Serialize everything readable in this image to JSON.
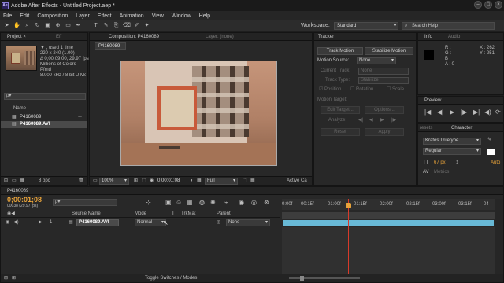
{
  "window": {
    "title": "Adobe After Effects - Untitled Project.aep *",
    "app_icon": "Ae"
  },
  "menu": [
    "File",
    "Edit",
    "Composition",
    "Layer",
    "Effect",
    "Animation",
    "View",
    "Window",
    "Help"
  ],
  "toolbar": {
    "workspace_label": "Workspace:",
    "workspace_value": "Standard",
    "search_placeholder": "Search Help"
  },
  "project": {
    "tab_label": "Project ×",
    "tab2_label": "Eff",
    "footage_name": "▼ , used 1 time",
    "footage_info": [
      "220 x 240 (1.00)",
      "Δ 0;00:09;00, 29.97 fps",
      "Millions of Colors",
      "Pfmd",
      "8.000 kHz / 8 bit U Mono"
    ],
    "search_placeholder": "ρ▾",
    "column_name": "Name",
    "items": [
      {
        "name": "P4160089",
        "type": "comp"
      },
      {
        "name": "P4160089.AVI",
        "type": "footage"
      }
    ],
    "bpc": "8 bpc"
  },
  "composition": {
    "tab_label": "Composition: P4160089",
    "layer_tab": "Layer: (none)",
    "comp_name": "P4160089",
    "zoom": "100%",
    "timecode": "0;00:01:08",
    "resolution": "Full",
    "camera": "Active Ca"
  },
  "tracker": {
    "tab_label": "Tracker",
    "track_motion": "Track Motion",
    "stabilize_motion": "Stabilize Motion",
    "motion_source_label": "Motion Source:",
    "motion_source_value": "None",
    "current_track_label": "Current Track:",
    "current_track_value": "None",
    "track_type_label": "Track Type:",
    "track_type_value": "Stabilize",
    "position": "Position",
    "rotation": "Rotation",
    "scale": "Scale",
    "motion_target": "Motion Target:",
    "edit_target": "Edit Target...",
    "options": "Options...",
    "analyze": "Analyze:",
    "reset": "Reset",
    "apply": "Apply"
  },
  "info": {
    "tab_label": "Info",
    "tab2_label": "Audio",
    "r": "R :",
    "g": "G :",
    "b": "B :",
    "a": "A : 0",
    "x": "X : 262",
    "y": "Y : 251"
  },
  "preview": {
    "tab_label": "Preview"
  },
  "character": {
    "tab1_label": "resets",
    "tab2_label": "Character",
    "font": "Kratos Truetype",
    "style": "Regular",
    "size": "67 px",
    "auto": "Auto",
    "metrics": "Metrics"
  },
  "timeline": {
    "tab_label": "P4160089",
    "timecode": "0;00:01;08",
    "fps": "00038 (29.97 fps)",
    "search_placeholder": "ρ▾",
    "col_source": "Source Name",
    "col_mode": "Mode",
    "col_t": "T",
    "col_trkmat": "TrkMat",
    "col_parent": "Parent",
    "layer_num": "1",
    "layer_name": "P4160089.AVI",
    "layer_mode": "Normal",
    "layer_parent": "None",
    "ruler": [
      "0:00f",
      "00:15f",
      "01:00f",
      "01:15f",
      "02:00f",
      "02:15f",
      "03:00f",
      "03:15f",
      "04"
    ],
    "toggle_label": "Toggle Switches / Modes"
  },
  "colors": {
    "accent_timecode": "#e8a33a",
    "layer_bar": "#68b9d6",
    "playhead": "#d83a2a"
  }
}
